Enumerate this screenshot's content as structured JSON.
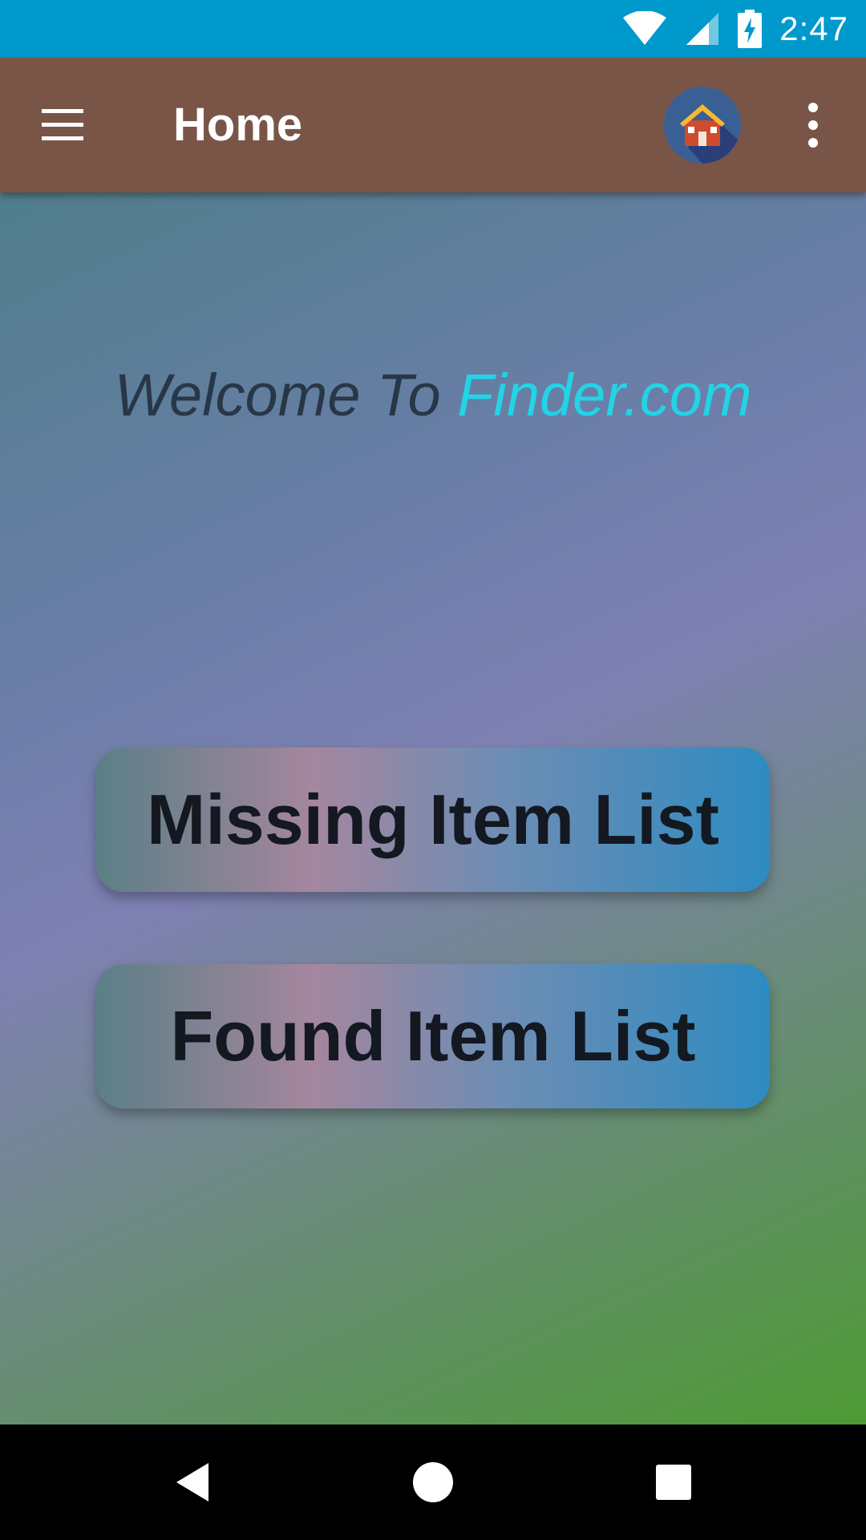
{
  "status_bar": {
    "time": "2:47",
    "icons": [
      "wifi-icon",
      "cell-signal-icon",
      "battery-charging-icon"
    ],
    "color": "#0099cc"
  },
  "app_bar": {
    "title": "Home",
    "color": "#795548",
    "icons": [
      "menu-icon",
      "house-avatar-icon",
      "more-vert-icon"
    ]
  },
  "main": {
    "welcome_prefix": "Welcome To ",
    "welcome_brand": "Finder.com",
    "brand_color": "#22d4e6",
    "buttons": {
      "missing_label": "Missing Item List",
      "found_label": "Found Item List"
    }
  },
  "nav_bar": {
    "icons": [
      "back-icon",
      "home-icon",
      "recents-icon"
    ]
  }
}
